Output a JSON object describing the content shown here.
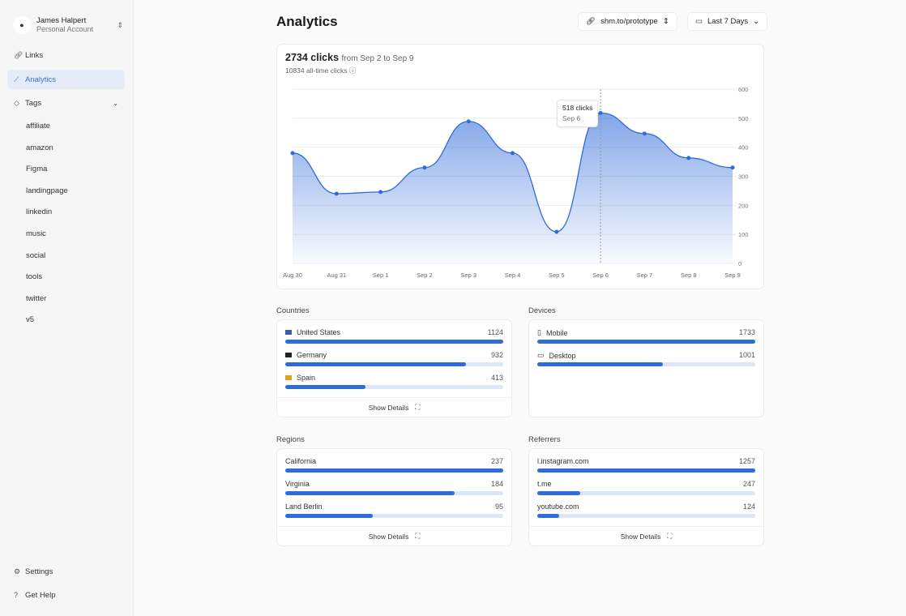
{
  "account": {
    "name": "James Halpert",
    "type": "Personal Account"
  },
  "nav": [
    {
      "label": "Links",
      "icon": "link-icon"
    },
    {
      "label": "Analytics",
      "icon": "chart-icon",
      "active": true
    },
    {
      "label": "Tags",
      "icon": "tag-icon"
    }
  ],
  "tags": [
    "affiliate",
    "amazon",
    "Figma",
    "landingpage",
    "linkedin",
    "music",
    "social",
    "tools",
    "twitter",
    "v5"
  ],
  "footer_nav": [
    {
      "label": "Settings",
      "icon": "gear-icon"
    },
    {
      "label": "Get Help",
      "icon": "help-icon"
    }
  ],
  "header": {
    "title": "Analytics",
    "link_selector": "shm.to/prototype",
    "range_selector": "Last 7 Days"
  },
  "summary": {
    "clicks": "2734 clicks",
    "range": "from Sep 2 to Sep 9",
    "all_time": "10834 all-time clicks"
  },
  "tooltip": {
    "clicks": "518 clicks",
    "date": "Sep 6"
  },
  "chart_data": {
    "type": "area",
    "categories": [
      "Aug 30",
      "Aug 31",
      "Sep 1",
      "Sep 2",
      "Sep 3",
      "Sep 4",
      "Sep 5",
      "Sep 6",
      "Sep 7",
      "Sep 8",
      "Sep 9"
    ],
    "values": [
      380,
      240,
      246,
      330,
      489,
      380,
      109,
      518,
      447,
      363,
      330
    ],
    "ylim": [
      0,
      600
    ],
    "yticks": [
      "0",
      "100",
      "200",
      "300",
      "400",
      "500",
      "600"
    ],
    "grid": true,
    "color": "#2f6bd9"
  },
  "countries": {
    "title": "Countries",
    "items": [
      {
        "label": "United States",
        "value": 1124,
        "value_text": "1124"
      },
      {
        "label": "Germany",
        "value": 932,
        "value_text": "932"
      },
      {
        "label": "Spain",
        "value": 413,
        "value_text": "413"
      }
    ],
    "details": "Show Details"
  },
  "devices": {
    "title": "Devices",
    "items": [
      {
        "label": "Mobile",
        "value": 1733,
        "value_text": "1733"
      },
      {
        "label": "Desktop",
        "value": 1001,
        "value_text": "1001"
      }
    ]
  },
  "regions": {
    "title": "Regions",
    "items": [
      {
        "label": "California",
        "value": 237,
        "value_text": "237"
      },
      {
        "label": "Virginia",
        "value": 184,
        "value_text": "184"
      },
      {
        "label": "Land Berlin",
        "value": 95,
        "value_text": "95"
      }
    ],
    "details": "Show Details"
  },
  "referrers": {
    "title": "Referrers",
    "items": [
      {
        "label": "l.instagram.com",
        "value": 1257,
        "value_text": "1257"
      },
      {
        "label": "t.me",
        "value": 247,
        "value_text": "247"
      },
      {
        "label": "youtube.com",
        "value": 124,
        "value_text": "124"
      }
    ],
    "details": "Show Details"
  }
}
